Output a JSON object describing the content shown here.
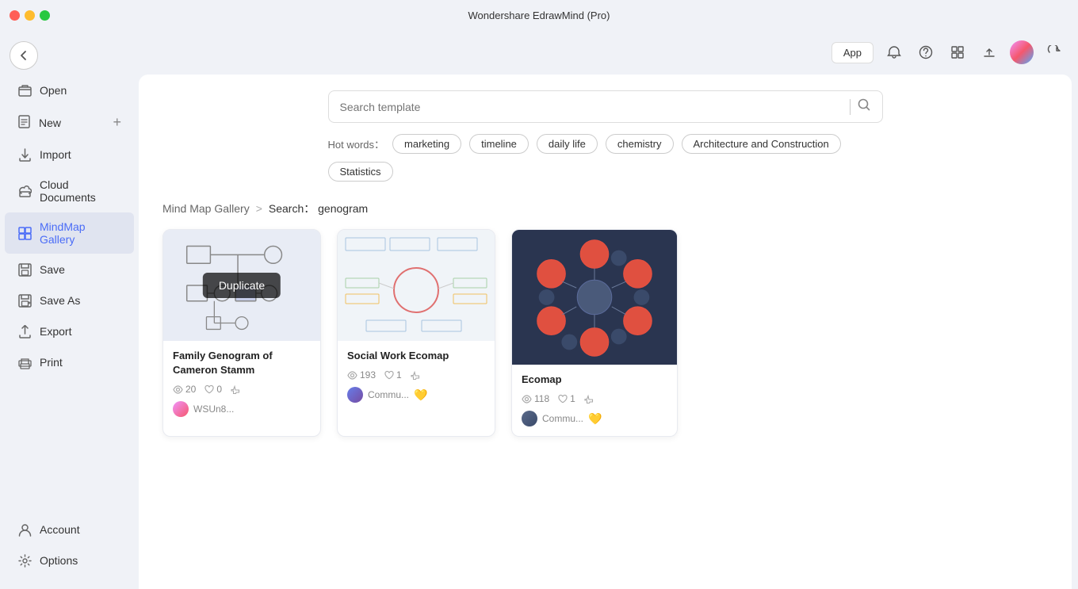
{
  "titlebar": {
    "title": "Wondershare EdrawMind (Pro)"
  },
  "sidebar": {
    "open_label": "Open",
    "new_label": "New",
    "import_label": "Import",
    "cloud_docs_label": "Cloud Documents",
    "mindmap_gallery_label": "MindMap Gallery",
    "save_label": "Save",
    "save_as_label": "Save As",
    "export_label": "Export",
    "print_label": "Print",
    "account_label": "Account",
    "options_label": "Options"
  },
  "topbar": {
    "app_button": "App"
  },
  "search": {
    "placeholder": "Search template",
    "query": ""
  },
  "hot_words": {
    "label": "Hot words：",
    "tags": [
      "marketing",
      "timeline",
      "daily life",
      "chemistry",
      "Architecture and Construction",
      "Statistics"
    ]
  },
  "breadcrumb": {
    "gallery": "Mind Map Gallery",
    "separator": ">",
    "search_label": "Search：",
    "query": "genogram"
  },
  "cards": [
    {
      "id": "card1",
      "title": "Family Genogram of Cameron Stamm",
      "views": 20,
      "likes": 0,
      "thumbs_up": 0,
      "author": "WSUn8...",
      "has_duplicate": true,
      "duplicate_label": "Duplicate"
    },
    {
      "id": "card2",
      "title": "Social Work Ecomap",
      "views": 193,
      "likes": 1,
      "thumbs_up": 0,
      "author": "Commu...",
      "is_premium": true,
      "has_duplicate": false
    },
    {
      "id": "card3",
      "title": "Ecomap",
      "views": 118,
      "likes": 1,
      "thumbs_up": 0,
      "author": "Commu...",
      "is_premium": true,
      "has_duplicate": false
    }
  ]
}
